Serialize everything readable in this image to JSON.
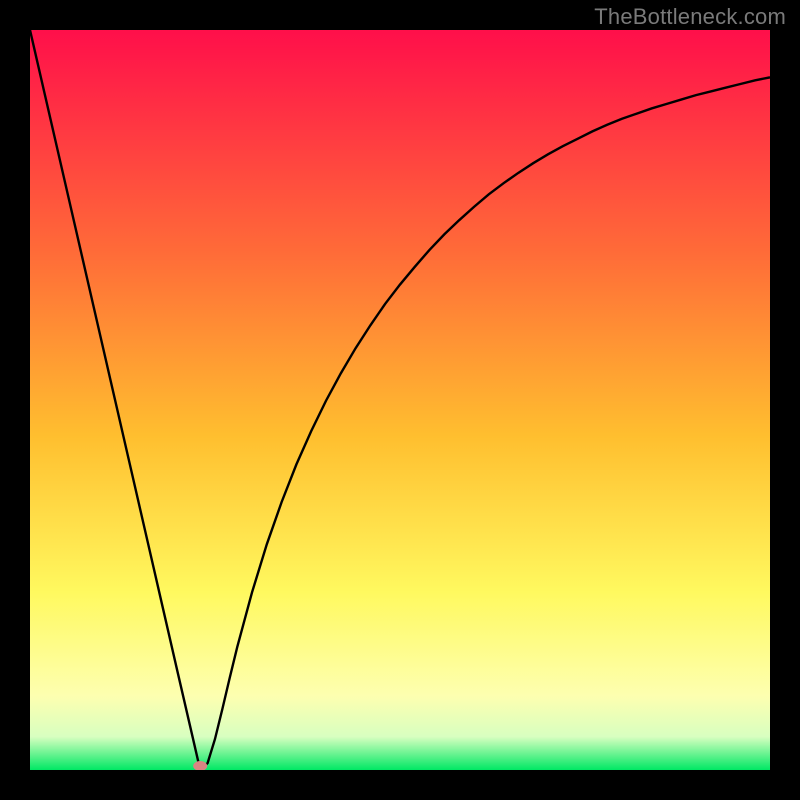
{
  "attribution": "TheBottleneck.com",
  "colors": {
    "frame": "#000000",
    "curve": "#000000",
    "marker_fill": "#d98582",
    "gradient_top": "#ff0f4a",
    "gradient_upper_mid": "#ff7d36",
    "gradient_mid": "#ffd233",
    "gradient_lower_mid": "#fdff82",
    "gradient_bottom": "#00e864"
  },
  "chart_data": {
    "type": "line",
    "title": "",
    "xlabel": "",
    "ylabel": "",
    "xlim": [
      0,
      100
    ],
    "ylim": [
      0,
      100
    ],
    "grid": false,
    "legend": false,
    "series": [
      {
        "name": "bottleneck-curve",
        "x": [
          0,
          2,
          4,
          6,
          8,
          10,
          12,
          14,
          16,
          18,
          20,
          22,
          23,
          24,
          25,
          26,
          27,
          28,
          30,
          32,
          34,
          36,
          38,
          40,
          42,
          44,
          46,
          48,
          50,
          52,
          54,
          56,
          58,
          60,
          62,
          64,
          66,
          68,
          70,
          72,
          74,
          76,
          78,
          80,
          82,
          84,
          86,
          88,
          90,
          92,
          94,
          96,
          98,
          100
        ],
        "y": [
          100.0,
          91.3,
          82.6,
          73.9,
          65.2,
          56.5,
          47.8,
          39.1,
          30.4,
          21.7,
          13.0,
          4.35,
          0.0,
          0.93,
          4.19,
          8.26,
          12.5,
          16.6,
          24.0,
          30.5,
          36.2,
          41.3,
          45.8,
          49.9,
          53.6,
          57.0,
          60.1,
          63.0,
          65.6,
          68.0,
          70.3,
          72.4,
          74.3,
          76.1,
          77.8,
          79.3,
          80.7,
          82.0,
          83.2,
          84.3,
          85.3,
          86.3,
          87.2,
          88.0,
          88.7,
          89.4,
          90.0,
          90.6,
          91.2,
          91.7,
          92.2,
          92.7,
          93.2,
          93.6
        ]
      }
    ],
    "marker": {
      "x": 23,
      "y": 0
    },
    "gradient_bands_y": {
      "red_to_orange": [
        100,
        50
      ],
      "orange_to_yellow": [
        50,
        25
      ],
      "yellow_to_paleyellow": [
        25,
        10
      ],
      "green_band": [
        4,
        0
      ]
    }
  }
}
